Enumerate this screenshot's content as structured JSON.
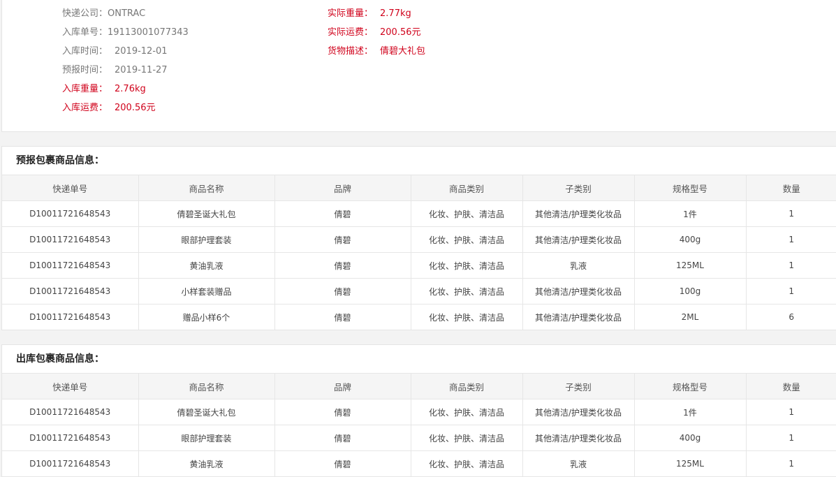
{
  "info": {
    "left": [
      {
        "label": "快递公司：",
        "value": "ONTRAC",
        "red": false,
        "gap": false
      },
      {
        "label": "入库单号：",
        "value": "19113001077343",
        "red": false,
        "gap": false
      },
      {
        "label": "入库时间：",
        "value": "2019-12-01",
        "red": false,
        "gap": true
      },
      {
        "label": "预报时间：",
        "value": "2019-11-27",
        "red": false,
        "gap": true
      },
      {
        "label": "入库重量：",
        "value": "2.76kg",
        "red": true,
        "gap": true
      },
      {
        "label": "入库运费：",
        "value": "200.56元",
        "red": true,
        "gap": true
      }
    ],
    "right": [
      {
        "label": "实际重量：",
        "value": "2.77kg",
        "red": true,
        "gap": true
      },
      {
        "label": "实际运费：",
        "value": "200.56元",
        "red": true,
        "gap": true
      },
      {
        "label": "货物描述：",
        "value": "倩碧大礼包",
        "red": true,
        "gap": true
      }
    ]
  },
  "columns": [
    "快递单号",
    "商品名称",
    "品牌",
    "商品类别",
    "子类别",
    "规格型号",
    "数量"
  ],
  "predicted": {
    "title": "预报包裹商品信息：",
    "rows": [
      [
        "D10011721648543",
        "倩碧圣诞大礼包",
        "倩碧",
        "化妆、护肤、清洁品",
        "其他清洁/护理类化妆品",
        "1件",
        "1"
      ],
      [
        "D10011721648543",
        "眼部护理套装",
        "倩碧",
        "化妆、护肤、清洁品",
        "其他清洁/护理类化妆品",
        "400g",
        "1"
      ],
      [
        "D10011721648543",
        "黄油乳液",
        "倩碧",
        "化妆、护肤、清洁品",
        "乳液",
        "125ML",
        "1"
      ],
      [
        "D10011721648543",
        "小样套装赠品",
        "倩碧",
        "化妆、护肤、清洁品",
        "其他清洁/护理类化妆品",
        "100g",
        "1"
      ],
      [
        "D10011721648543",
        "赠品小样6个",
        "倩碧",
        "化妆、护肤、清洁品",
        "其他清洁/护理类化妆品",
        "2ML",
        "6"
      ]
    ]
  },
  "outbound": {
    "title": "出库包裹商品信息：",
    "rows": [
      [
        "D10011721648543",
        "倩碧圣诞大礼包",
        "倩碧",
        "化妆、护肤、清洁品",
        "其他清洁/护理类化妆品",
        "1件",
        "1"
      ],
      [
        "D10011721648543",
        "眼部护理套装",
        "倩碧",
        "化妆、护肤、清洁品",
        "其他清洁/护理类化妆品",
        "400g",
        "1"
      ],
      [
        "D10011721648543",
        "黄油乳液",
        "倩碧",
        "化妆、护肤、清洁品",
        "乳液",
        "125ML",
        "1"
      ]
    ]
  },
  "colors": {
    "accent_red": "#d0021b",
    "muted": "#777777",
    "header_bg": "#f5f5f5"
  }
}
